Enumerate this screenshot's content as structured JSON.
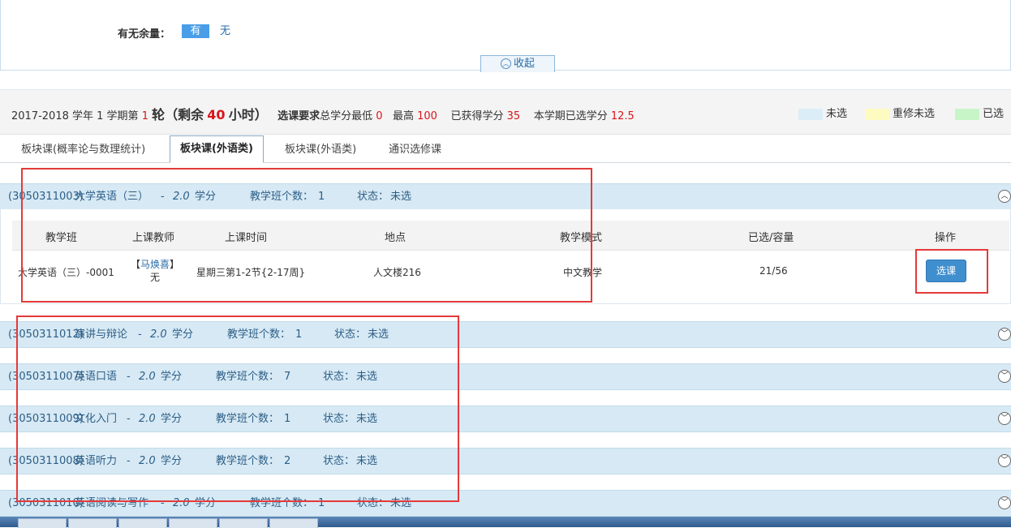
{
  "filter": {
    "label": "有无余量：",
    "option_yes": "有",
    "option_no": "无",
    "collapse_label": "收起"
  },
  "info": {
    "year": "2017-2018",
    "text1": "学年 1 学期第",
    "round": "1",
    "text2": "轮（",
    "remaining_prefix": "剩余",
    "remaining_hours": "40",
    "remaining_suffix": "小时）",
    "req_label": "选课要求",
    "req_text": "总学分最低",
    "min_credit": "0",
    "max_label": "最高",
    "max_credit": "100",
    "earned_label": "已获得学分",
    "earned_credit": "35",
    "selected_label": "本学期已选学分",
    "selected_credit": "12.5"
  },
  "legend": [
    {
      "label": "未选",
      "color": "#dbeef8"
    },
    {
      "label": "重修未选",
      "color": "#fdfbc0"
    },
    {
      "label": "已选",
      "color": "#c8f5c8"
    }
  ],
  "tabs": [
    {
      "label": "板块课(概率论与数理统计)"
    },
    {
      "label": "板块课(外语类)"
    },
    {
      "label": "板块课(外语类)"
    },
    {
      "label": "通识选修课"
    }
  ],
  "courses": [
    {
      "code": "(3050311003)",
      "name": "大学英语（三）",
      "dash": "-",
      "credit": "2.0",
      "credit_unit": "学分",
      "classes_label": "教学班个数：",
      "classes": "1",
      "status_label": "状态：",
      "status": "未选"
    },
    {
      "code": "(3050311012)",
      "name": "演讲与辩论",
      "dash": "-",
      "credit": "2.0",
      "credit_unit": "学分",
      "classes_label": "教学班个数：",
      "classes": "1",
      "status_label": "状态：",
      "status": "未选"
    },
    {
      "code": "(3050311007)",
      "name": "英语口语",
      "dash": "-",
      "credit": "2.0",
      "credit_unit": "学分",
      "classes_label": "教学班个数：",
      "classes": "7",
      "status_label": "状态：",
      "status": "未选"
    },
    {
      "code": "(3050311009)",
      "name": "文化入门",
      "dash": "-",
      "credit": "2.0",
      "credit_unit": "学分",
      "classes_label": "教学班个数：",
      "classes": "1",
      "status_label": "状态：",
      "status": "未选"
    },
    {
      "code": "(3050311008)",
      "name": "英语听力",
      "dash": "-",
      "credit": "2.0",
      "credit_unit": "学分",
      "classes_label": "教学班个数：",
      "classes": "2",
      "status_label": "状态：",
      "status": "未选"
    },
    {
      "code": "(3050311010)",
      "name": "英语阅读与写作",
      "dash": "-",
      "credit": "2.0",
      "credit_unit": "学分",
      "classes_label": "教学班个数：",
      "classes": "1",
      "status_label": "状态：",
      "status": "未选"
    }
  ],
  "table": {
    "headers": [
      "教学班",
      "上课教师",
      "上课时间",
      "地点",
      "教学模式",
      "已选/容量",
      "操作"
    ],
    "row": {
      "class_name": "大学英语（三）-0001",
      "teacher": "马焕喜",
      "teacher_title": "无",
      "time": "星期三第1-2节{2-17周}",
      "location": "人文楼216",
      "mode": "中文教学",
      "capacity": "21/56",
      "action": "选课"
    }
  }
}
